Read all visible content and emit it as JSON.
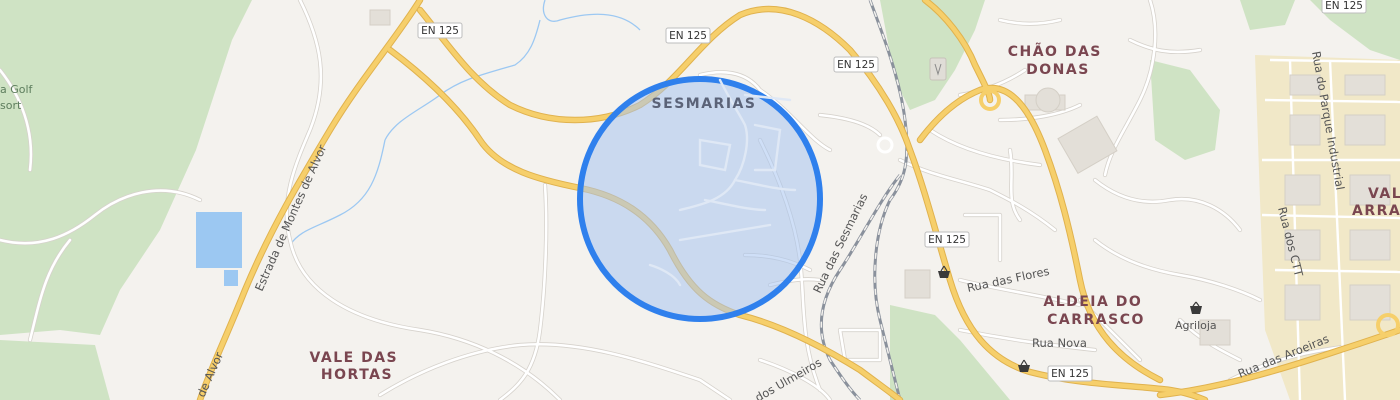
{
  "map": {
    "areas": {
      "sesmarias": "SESMARIAS",
      "chao_das_donas": [
        "CHÃO DAS",
        "DONAS"
      ],
      "vale_das_hortas": [
        "VALE DAS",
        "HORTAS"
      ],
      "aldeia_do_carrasco": [
        "ALDEIA DO",
        "CARRASCO"
      ],
      "vale_arran": [
        "VALE",
        "ARRAN"
      ]
    },
    "road_shields": {
      "en125": "EN 125"
    },
    "streets": {
      "estrada_montes_alvor": "Estrada de Montes de Alvor",
      "rua_das_sesmarias": "Rua das Sesmarias",
      "rua_das_flores": "Rua das Flores",
      "rua_nova": "Rua Nova",
      "rua_das_aroeiras": "Rua das Aroeiras",
      "rua_dos_ulmeiros": "dos Ulmeiros",
      "rua_do_parque_industrial": "Rua do Parque Industrial",
      "rua_dos_ctt": "Rua dos CTT",
      "de_alvor": "de Alvor"
    },
    "pois": {
      "agriloja": "Agriloja",
      "golf_line1": "a Golf",
      "golf_line2": "sort"
    },
    "icons": [
      "shopping-basket-icon",
      "shopping-bag-icon",
      "parking-icon"
    ],
    "colors": {
      "background": "#f4f2ee",
      "green": "#cfe3c4",
      "main_road": "#f6cf6b",
      "water": "#9cc8f2",
      "marker_fill": "#a8c5f0",
      "marker_stroke": "#2f80ed",
      "rail": "#8a919c"
    }
  }
}
